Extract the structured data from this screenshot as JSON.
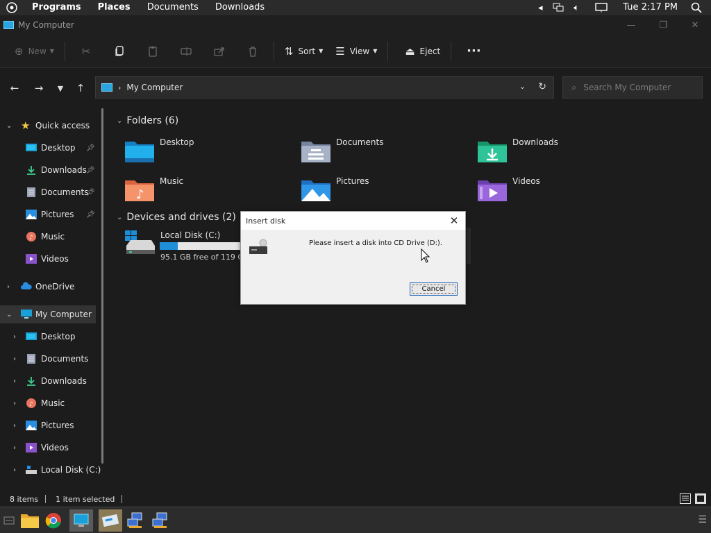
{
  "top_panel": {
    "menus": [
      "Programs",
      "Places",
      "Documents",
      "Downloads"
    ],
    "clock": "Tue 2:17 PM"
  },
  "window": {
    "title": "My Computer"
  },
  "command_bar": {
    "new_label": "New",
    "sort_label": "Sort",
    "view_label": "View",
    "eject_label": "Eject"
  },
  "address": {
    "crumb": "My Computer",
    "search_placeholder": "Search My Computer"
  },
  "sidebar": {
    "quick_access": "Quick access",
    "quick_items": [
      "Desktop",
      "Downloads",
      "Documents",
      "Pictures",
      "Music",
      "Videos"
    ],
    "onedrive": "OneDrive",
    "my_computer": "My Computer",
    "pc_items": [
      "Desktop",
      "Documents",
      "Downloads",
      "Music",
      "Pictures",
      "Videos",
      "Local Disk (C:)"
    ]
  },
  "content": {
    "folders_header": "Folders (6)",
    "folders": [
      "Desktop",
      "Documents",
      "Downloads",
      "Music",
      "Pictures",
      "Videos"
    ],
    "devices_header": "Devices and drives (2)",
    "drive": {
      "label": "Local Disk (C:)",
      "free_text": "95.1 GB free of 119 GB",
      "used_fraction": 0.2
    }
  },
  "dialog": {
    "title": "Insert disk",
    "message": "Please insert a disk into CD Drive (D:).",
    "cancel_label": "Cancel"
  },
  "status": {
    "items": "8 items",
    "selected": "1 item selected"
  },
  "colors": {
    "accent": "#1e8ed9",
    "background": "#1c1c1c"
  }
}
